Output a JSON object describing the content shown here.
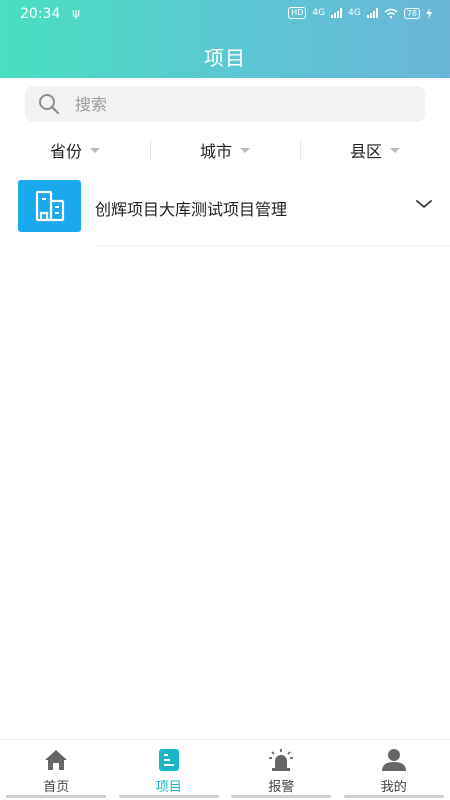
{
  "status_bar": {
    "time": "20:34",
    "usb_glyph": "ψ",
    "hd": "HD",
    "net1": "4G",
    "net2": "4G",
    "battery": "78"
  },
  "header": {
    "title": "项目"
  },
  "search": {
    "placeholder": "搜索"
  },
  "filters": [
    {
      "label": "省份"
    },
    {
      "label": "城市"
    },
    {
      "label": "县区"
    }
  ],
  "projects": [
    {
      "name": "创辉项目大库测试项目管理"
    }
  ],
  "tabbar": {
    "items": [
      {
        "label": "首页",
        "icon": "home-icon"
      },
      {
        "label": "项目",
        "icon": "project-icon",
        "active": true
      },
      {
        "label": "报警",
        "icon": "alarm-icon"
      },
      {
        "label": "我的",
        "icon": "user-icon"
      }
    ]
  },
  "colors": {
    "accent": "#19b6c6",
    "header_start": "#49dfc0",
    "header_end": "#6bb6d9",
    "thumb": "#1ba9ee"
  }
}
